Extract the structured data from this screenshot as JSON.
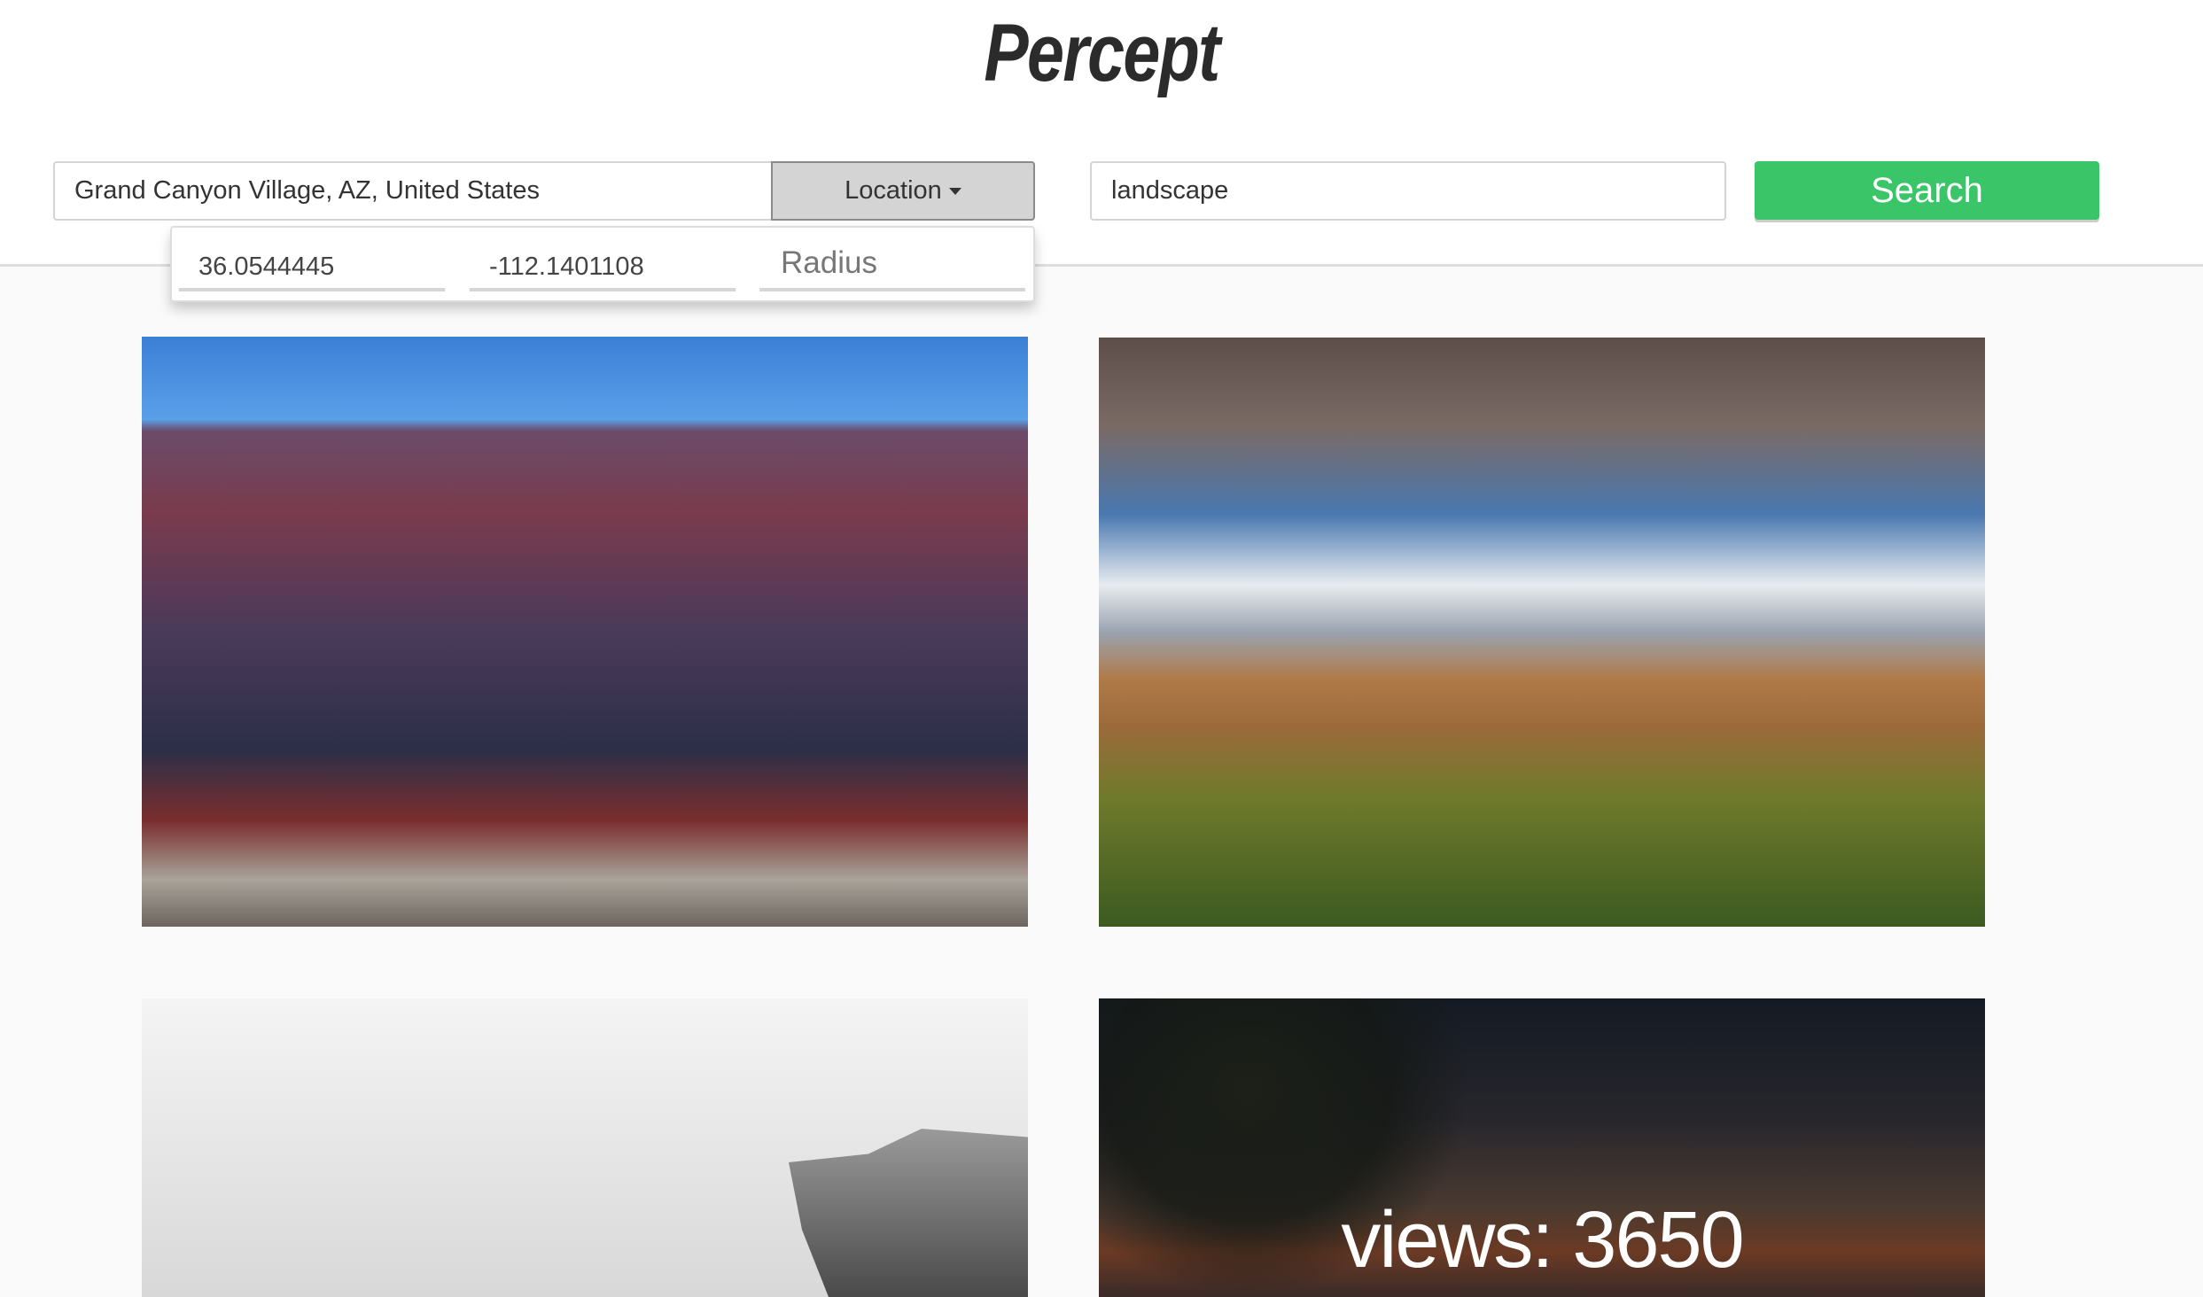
{
  "app": {
    "title": "Percept"
  },
  "search_bar": {
    "location_value": "Grand Canyon Village, AZ, United States",
    "location_button_label": "Location",
    "keyword_value": "landscape",
    "search_button_label": "Search"
  },
  "location_dropdown": {
    "latitude": "36.0544445",
    "longitude": "-112.1401108",
    "radius_placeholder": "Radius"
  },
  "results": [
    {
      "description": "Grand Canyon canyon view at dusk"
    },
    {
      "description": "Rainbow over Grand Canyon"
    },
    {
      "description": "Black and white cliff with person"
    },
    {
      "description": "Grand Canyon at sunset with tree",
      "overlay": "views: 3650"
    }
  ],
  "colors": {
    "accent": "#3ac569",
    "title": "#2b2b2b"
  }
}
